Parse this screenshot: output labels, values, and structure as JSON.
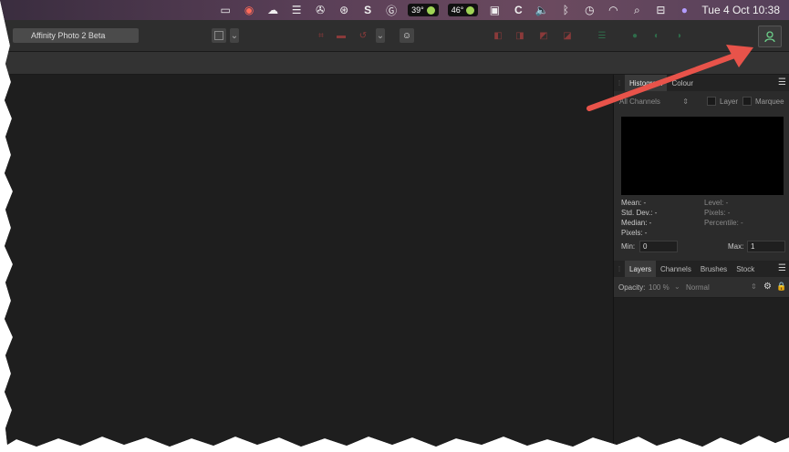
{
  "menubar": {
    "weather1": "39°",
    "weather2": "46°",
    "datetime": "Tue 4 Oct  10:38",
    "icons": [
      "screen-icon",
      "creative-cloud-icon",
      "cloud-icon",
      "menu-grid-icon",
      "aperture-icon",
      "antivirus-icon",
      "s-icon",
      "g-icon",
      "weather-icon",
      "weather-icon",
      "clipboard-icon",
      "c-icon",
      "volume-icon",
      "bluetooth-icon",
      "time-machine-icon",
      "wifi-icon",
      "search-icon",
      "control-center-icon",
      "siri-icon"
    ]
  },
  "toolbar": {
    "doc_title": "Affinity Photo 2 Beta",
    "account_icon": "person-icon"
  },
  "histogram": {
    "tabs": [
      "Histogram",
      "Colour"
    ],
    "channels": "All Channels",
    "layer_label": "Layer",
    "marquee_label": "Marquee",
    "mean": "Mean: -",
    "std_dev": "Std. Dev.: -",
    "median": "Median: -",
    "pixels_left": "Pixels: -",
    "level": "Level: -",
    "pixels_right": "Pixels: -",
    "percentile": "Percentile: -",
    "min_label": "Min:",
    "min_value": "0",
    "max_label": "Max:",
    "max_value": "1"
  },
  "layers": {
    "tabs": [
      "Layers",
      "Channels",
      "Brushes",
      "Stock"
    ],
    "opacity_label": "Opacity:",
    "opacity_value": "100 %",
    "blend_mode": "Normal"
  },
  "colors": {
    "accent_green": "#6ccf8a",
    "arrow_red": "#e8534a"
  }
}
